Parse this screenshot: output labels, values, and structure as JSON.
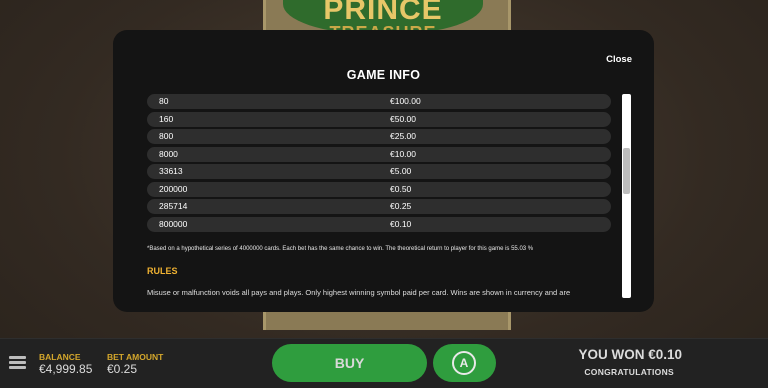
{
  "background": {
    "logo_line1": "PRINCE",
    "logo_line2": "TREASURE"
  },
  "modal": {
    "title": "GAME INFO",
    "close_label": "Close",
    "rows": [
      {
        "col1": "80",
        "col2": "€100.00"
      },
      {
        "col1": "160",
        "col2": "€50.00"
      },
      {
        "col1": "800",
        "col2": "€25.00"
      },
      {
        "col1": "8000",
        "col2": "€10.00"
      },
      {
        "col1": "33613",
        "col2": "€5.00"
      },
      {
        "col1": "200000",
        "col2": "€0.50"
      },
      {
        "col1": "285714",
        "col2": "€0.25"
      },
      {
        "col1": "800000",
        "col2": "€0.10"
      }
    ],
    "note": "*Based on a hypothetical series of 4000000 cards. Each bet has the same chance to win. The theoretical return to player for this game is 55.03 %",
    "rules_heading": "RULES",
    "rules_text": "Misuse or malfunction voids all pays and plays. Only highest winning symbol paid per card. Wins are shown in currency and are"
  },
  "bottombar": {
    "balance_label": "BALANCE",
    "balance_value": "€4,999.85",
    "bet_label": "BET AMOUNT",
    "bet_value": "€0.25",
    "buy_label": "BUY",
    "auto_icon": "autoplay-icon",
    "auto_symbol": "A",
    "won_text": "YOU WON €0.10",
    "congrats_text": "CONGRATULATIONS"
  },
  "colors": {
    "accent_gold": "#d4a72c",
    "button_green": "#2f9d3e",
    "modal_bg": "#141414",
    "row_bg": "#2e2e2e"
  }
}
